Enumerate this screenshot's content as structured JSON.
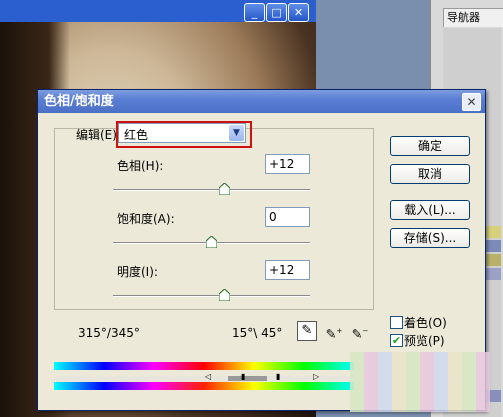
{
  "dialog": {
    "title": "色相/饱和度",
    "close_glyph": "✕",
    "edit_label": "编辑(E):",
    "edit_value": "红色",
    "hue_label": "色相(H):",
    "hue_value": "+12",
    "saturation_label": "饱和度(A):",
    "saturation_value": "0",
    "lightness_label": "明度(I):",
    "lightness_value": "+12",
    "range_left": "315°/345°",
    "range_right": "15°\\ 45°",
    "buttons": {
      "ok": "确定",
      "cancel": "取消",
      "load": "载入(L)...",
      "save": "存储(S)..."
    },
    "colorize_label": "着色(O)",
    "colorize_checked": false,
    "preview_label": "预览(P)",
    "preview_checked": true
  },
  "navigator": {
    "tab_label": "导航器"
  },
  "image_window": {
    "minimize_glyph": "_",
    "maximize_glyph": "□",
    "close_glyph": "✕"
  },
  "icons": [
    "minimize-icon",
    "maximize-icon",
    "close-icon",
    "dropdown-arrow-icon",
    "slider-thumb-icon",
    "eyedropper-icon",
    "eyedropper-plus-icon",
    "eyedropper-minus-icon",
    "checkbox-check-icon"
  ],
  "colors": {
    "titlebar": "#5a7fd4",
    "dialog_bg": "#ece9d8",
    "highlight": "#d01010"
  }
}
